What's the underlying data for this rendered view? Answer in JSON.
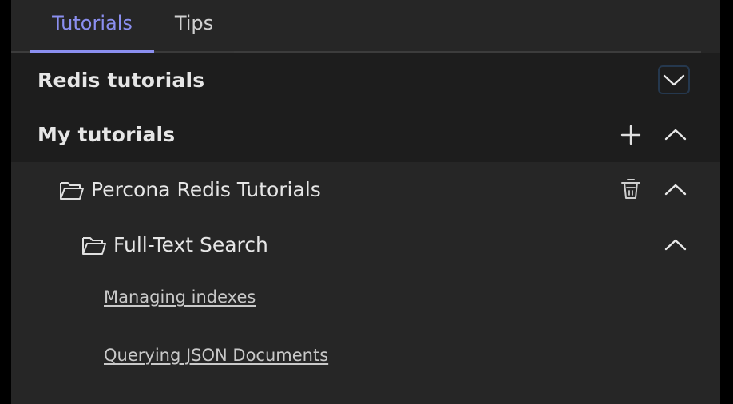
{
  "tabs": [
    {
      "label": "Tutorials",
      "active": true
    },
    {
      "label": "Tips",
      "active": false
    }
  ],
  "sections": {
    "redis_tutorials": {
      "title": "Redis tutorials",
      "state": "collapsed"
    },
    "my_tutorials": {
      "title": "My tutorials",
      "state": "expanded"
    }
  },
  "folders": {
    "percona": {
      "label": "Percona Redis Tutorials"
    },
    "fulltext": {
      "label": "Full-Text Search"
    }
  },
  "links": [
    {
      "label": "Managing indexes"
    },
    {
      "label": "Querying JSON Documents"
    }
  ],
  "icons": {
    "add": "plus-icon",
    "delete": "trash-icon",
    "folder": "folder-icon",
    "expand": "chevron-down-icon",
    "collapse": "chevron-up-icon"
  },
  "colors": {
    "accent": "#8b8ff0",
    "focus_ring": "#25384e"
  }
}
